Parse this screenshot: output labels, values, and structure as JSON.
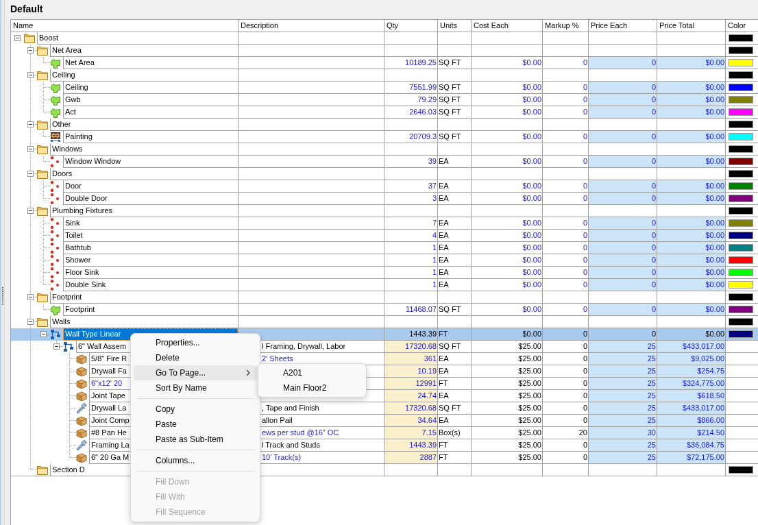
{
  "panel": {
    "title": "Default"
  },
  "table": {
    "columns": [
      "Name",
      "Description",
      "Qty",
      "Units",
      "Cost Each",
      "Markup %",
      "Price Each",
      "Price Total",
      "Color"
    ],
    "rows": [
      {
        "name": "Boost",
        "kind": "folder",
        "selected": false,
        "expanded": true,
        "color": "#000000",
        "children": [
          {
            "name": "Net Area",
            "kind": "folder",
            "selected": false,
            "expanded": true,
            "color": "#000000",
            "children": [
              {
                "name": "Net Area",
                "kind": "area",
                "selected": false,
                "assembly": false,
                "qty": "10189.25",
                "units": "SQ FT",
                "cost_each": "$0.00",
                "markup": "0",
                "price_each": "0",
                "price_total": "$0.00",
                "color": "#ffff00"
              }
            ]
          },
          {
            "name": "Ceiling",
            "kind": "folder",
            "selected": false,
            "expanded": true,
            "color": "#000000",
            "children": [
              {
                "name": "Ceiling",
                "kind": "area",
                "selected": false,
                "assembly": false,
                "qty": "7551.99",
                "units": "SQ FT",
                "cost_each": "$0.00",
                "markup": "0",
                "price_each": "0",
                "price_total": "$0.00",
                "color": "#0000ff"
              },
              {
                "name": "Gwb",
                "kind": "area",
                "selected": false,
                "assembly": false,
                "qty": "79.29",
                "units": "SQ FT",
                "cost_each": "$0.00",
                "markup": "0",
                "price_each": "0",
                "price_total": "$0.00",
                "color": "#808000"
              },
              {
                "name": "Act",
                "kind": "area",
                "selected": false,
                "assembly": false,
                "qty": "2646.03",
                "units": "SQ FT",
                "cost_each": "$0.00",
                "markup": "0",
                "price_each": "0",
                "price_total": "$0.00",
                "color": "#ff00ff"
              }
            ]
          },
          {
            "name": "Other",
            "kind": "folder",
            "selected": false,
            "expanded": true,
            "color": "#000000",
            "children": [
              {
                "name": "Painting",
                "kind": "surface",
                "selected": false,
                "assembly": false,
                "qty": "20709.3",
                "units": "SQ FT",
                "cost_each": "$0.00",
                "markup": "0",
                "price_each": "0",
                "price_total": "$0.00",
                "color": "#00ffff"
              }
            ]
          },
          {
            "name": "Windows",
            "kind": "folder",
            "selected": false,
            "expanded": true,
            "color": "#000000",
            "children": [
              {
                "name": "Window Window",
                "kind": "count",
                "selected": false,
                "assembly": false,
                "qty": "39",
                "units": "EA",
                "cost_each": "$0.00",
                "markup": "0",
                "price_each": "0",
                "price_total": "$0.00",
                "color": "#800000"
              }
            ]
          },
          {
            "name": "Doors",
            "kind": "folder",
            "selected": false,
            "expanded": true,
            "color": "#000000",
            "children": [
              {
                "name": "Door",
                "kind": "count",
                "selected": false,
                "assembly": false,
                "qty": "37",
                "units": "EA",
                "cost_each": "$0.00",
                "markup": "0",
                "price_each": "0",
                "price_total": "$0.00",
                "color": "#008000"
              },
              {
                "name": "Double Door",
                "kind": "count",
                "selected": false,
                "assembly": false,
                "qty": "3",
                "units": "EA",
                "cost_each": "$0.00",
                "markup": "0",
                "price_each": "0",
                "price_total": "$0.00",
                "color": "#800080"
              }
            ]
          },
          {
            "name": "Plumbing Fixtures",
            "kind": "folder",
            "selected": false,
            "expanded": true,
            "color": "#000000",
            "children": [
              {
                "name": "Sink",
                "kind": "count",
                "selected": false,
                "assembly": false,
                "qty": "7",
                "units": "EA",
                "cost_each": "$0.00",
                "markup": "0",
                "price_each": "0",
                "price_total": "$0.00",
                "color": "#808000"
              },
              {
                "name": "Toilet",
                "kind": "count",
                "selected": false,
                "assembly": false,
                "qty": "4",
                "units": "EA",
                "cost_each": "$0.00",
                "markup": "0",
                "price_each": "0",
                "price_total": "$0.00",
                "color": "#000080"
              },
              {
                "name": "Bathtub",
                "kind": "count",
                "selected": false,
                "assembly": false,
                "qty": "1",
                "units": "EA",
                "cost_each": "$0.00",
                "markup": "0",
                "price_each": "0",
                "price_total": "$0.00",
                "color": "#008080"
              },
              {
                "name": "Shower",
                "kind": "count",
                "selected": false,
                "assembly": false,
                "qty": "1",
                "units": "EA",
                "cost_each": "$0.00",
                "markup": "0",
                "price_each": "0",
                "price_total": "$0.00",
                "color": "#ff0000"
              },
              {
                "name": "Floor Sink",
                "kind": "count",
                "selected": false,
                "assembly": false,
                "qty": "1",
                "units": "EA",
                "cost_each": "$0.00",
                "markup": "0",
                "price_each": "0",
                "price_total": "$0.00",
                "color": "#00ff00"
              },
              {
                "name": "Double Sink",
                "kind": "count",
                "selected": false,
                "assembly": false,
                "qty": "1",
                "units": "EA",
                "cost_each": "$0.00",
                "markup": "0",
                "price_each": "0",
                "price_total": "$0.00",
                "color": "#ffff00"
              }
            ]
          },
          {
            "name": "Footprint",
            "kind": "folder",
            "selected": false,
            "expanded": true,
            "color": "#000000",
            "children": [
              {
                "name": "Footprint",
                "kind": "area",
                "selected": false,
                "assembly": false,
                "qty": "11468.07",
                "units": "SQ FT",
                "cost_each": "$0.00",
                "markup": "0",
                "price_each": "0",
                "price_total": "$0.00",
                "color": "#800080"
              }
            ]
          },
          {
            "name": "Walls",
            "kind": "folder",
            "selected": false,
            "expanded": true,
            "color": "#000000",
            "children": [
              {
                "name": "Wall Type Linear",
                "kind": "linear",
                "selected": true,
                "expanded": true,
                "assembly": false,
                "qty": "1443.39",
                "units": "FT",
                "cost_each": "$0.00",
                "markup": "0",
                "price_each": "0",
                "price_total": "$0.00",
                "color": "#000080",
                "children": [
                  {
                    "name": "6\" Wall Assem",
                    "kind": "assembly",
                    "selected": false,
                    "expanded": true,
                    "assembly": true,
                    "name_linked": false,
                    "description": "l Framing, Drywall, Labor",
                    "description_linked": false,
                    "qty": "17320.68",
                    "units": "SQ FT",
                    "cost_each": "$25.00",
                    "markup": "0",
                    "price_each": "25",
                    "price_total": "$433,017.00",
                    "children": [
                      {
                        "name": "5/8\" Fire R",
                        "kind": "material",
                        "selected": false,
                        "assembly": true,
                        "name_linked": false,
                        "description": "2' Sheets",
                        "description_linked": true,
                        "qty": "361",
                        "units": "EA",
                        "cost_each": "$25.00",
                        "markup": "0",
                        "price_each": "25",
                        "price_total": "$9,025.00"
                      },
                      {
                        "name": "Drywall Fa",
                        "kind": "material",
                        "selected": false,
                        "assembly": true,
                        "name_linked": false,
                        "qty": "10.19",
                        "units": "EA",
                        "cost_each": "$25.00",
                        "markup": "0",
                        "price_each": "25",
                        "price_total": "$254.75"
                      },
                      {
                        "name": "6\"x12' 20",
                        "kind": "material",
                        "selected": false,
                        "assembly": true,
                        "name_linked": true,
                        "qty": "12991",
                        "units": "FT",
                        "cost_each": "$25.00",
                        "markup": "0",
                        "price_each": "25",
                        "price_total": "$324,775.00"
                      },
                      {
                        "name": "Joint Tape",
                        "kind": "material",
                        "selected": false,
                        "assembly": true,
                        "name_linked": false,
                        "qty": "24.74",
                        "units": "EA",
                        "cost_each": "$25.00",
                        "markup": "0",
                        "price_each": "25",
                        "price_total": "$618.50"
                      },
                      {
                        "name": "Drywall La",
                        "kind": "labor",
                        "selected": false,
                        "assembly": true,
                        "name_linked": false,
                        "description": ", Tape and Finish",
                        "description_linked": false,
                        "qty": "17320.68",
                        "units": "SQ FT",
                        "cost_each": "$25.00",
                        "markup": "0",
                        "price_each": "25",
                        "price_total": "$433,017.00"
                      },
                      {
                        "name": "Joint Comp",
                        "kind": "material",
                        "selected": false,
                        "assembly": true,
                        "name_linked": false,
                        "description": "allon Pail",
                        "description_linked": false,
                        "qty": "34.64",
                        "units": "EA",
                        "cost_each": "$25.00",
                        "markup": "0",
                        "price_each": "25",
                        "price_total": "$866.00"
                      },
                      {
                        "name": "#8 Pan He",
                        "kind": "material",
                        "selected": false,
                        "assembly": true,
                        "name_linked": false,
                        "description": "ews per stud @16\" OC",
                        "description_linked": true,
                        "qty": "7.15",
                        "units": "Box(s)",
                        "cost_each": "$25.00",
                        "markup": "20",
                        "price_each": "30",
                        "price_total": "$214.50"
                      },
                      {
                        "name": "Framing La",
                        "kind": "labor",
                        "selected": false,
                        "assembly": true,
                        "name_linked": false,
                        "description": "l Track and Studs",
                        "description_linked": false,
                        "qty": "1443.39",
                        "units": "FT",
                        "cost_each": "$25.00",
                        "markup": "0",
                        "price_each": "25",
                        "price_total": "$36,084.75"
                      },
                      {
                        "name": "6\" 20 Ga M",
                        "kind": "material",
                        "selected": false,
                        "assembly": true,
                        "name_linked": false,
                        "description": "10' Track(s)",
                        "description_linked": true,
                        "qty": "2887",
                        "units": "FT",
                        "cost_each": "$25.00",
                        "markup": "0",
                        "price_each": "25",
                        "price_total": "$72,175.00"
                      }
                    ]
                  }
                ]
              }
            ]
          },
          {
            "name": "Section D",
            "kind": "folder",
            "selected": false,
            "color": "#000000"
          }
        ]
      }
    ]
  },
  "context_menu": {
    "items": [
      {
        "kind": "item",
        "label": "Properties...",
        "selected": false,
        "disabled": false
      },
      {
        "kind": "item",
        "label": "Delete",
        "selected": false,
        "disabled": false
      },
      {
        "kind": "item",
        "label": "Go To Page...",
        "selected": true,
        "disabled": false,
        "submenu": [
          {
            "label": "A201",
            "selected": false
          },
          {
            "label": "Main Floor2",
            "selected": false
          }
        ]
      },
      {
        "kind": "item",
        "label": "Sort By Name",
        "selected": false,
        "disabled": false
      },
      {
        "kind": "separator"
      },
      {
        "kind": "item",
        "label": "Copy",
        "selected": false,
        "disabled": false
      },
      {
        "kind": "item",
        "label": "Paste",
        "selected": false,
        "disabled": false
      },
      {
        "kind": "item",
        "label": "Paste as Sub-Item",
        "selected": false,
        "disabled": false
      },
      {
        "kind": "separator"
      },
      {
        "kind": "item",
        "label": "Columns...",
        "selected": false,
        "disabled": false
      },
      {
        "kind": "separator"
      },
      {
        "kind": "item",
        "label": "Fill Down",
        "selected": false,
        "disabled": true
      },
      {
        "kind": "item",
        "label": "Fill With",
        "selected": false,
        "disabled": true
      },
      {
        "kind": "item",
        "label": "Fill Sequence",
        "selected": false,
        "disabled": true
      }
    ]
  }
}
